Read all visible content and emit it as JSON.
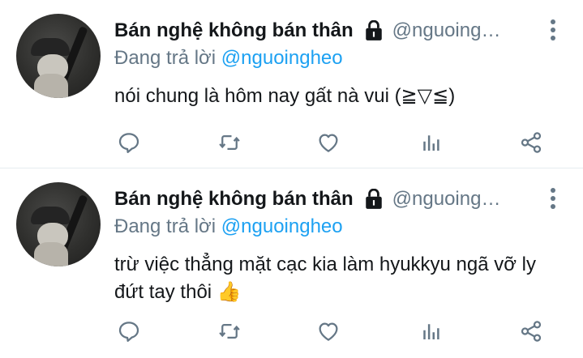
{
  "tweets": [
    {
      "display_name": "Bán nghệ không bán thân",
      "handle": "@nguoing…",
      "replying_prefix": "Đang trả lời",
      "replying_to": "@nguoingheo",
      "text": "nói chung là hôm nay gất nà vui (≧▽≦)"
    },
    {
      "display_name": "Bán nghệ không bán thân",
      "handle": "@nguoing…",
      "replying_prefix": "Đang trả lời",
      "replying_to": "@nguoingheo",
      "text": "trừ việc thẳng mặt cạc kia làm hyukkyu ngã vỡ ly đứt tay thôi 👍"
    }
  ],
  "icons": {
    "lock": "lock-icon",
    "more": "more-vertical-icon",
    "reply": "comment-icon",
    "retweet": "retweet-icon",
    "like": "heart-icon",
    "stats": "analytics-icon",
    "share": "share-icon"
  },
  "colors": {
    "text": "#14171a",
    "secondary": "#657786",
    "link": "#1da1f2",
    "divider": "#e6ecf0"
  }
}
